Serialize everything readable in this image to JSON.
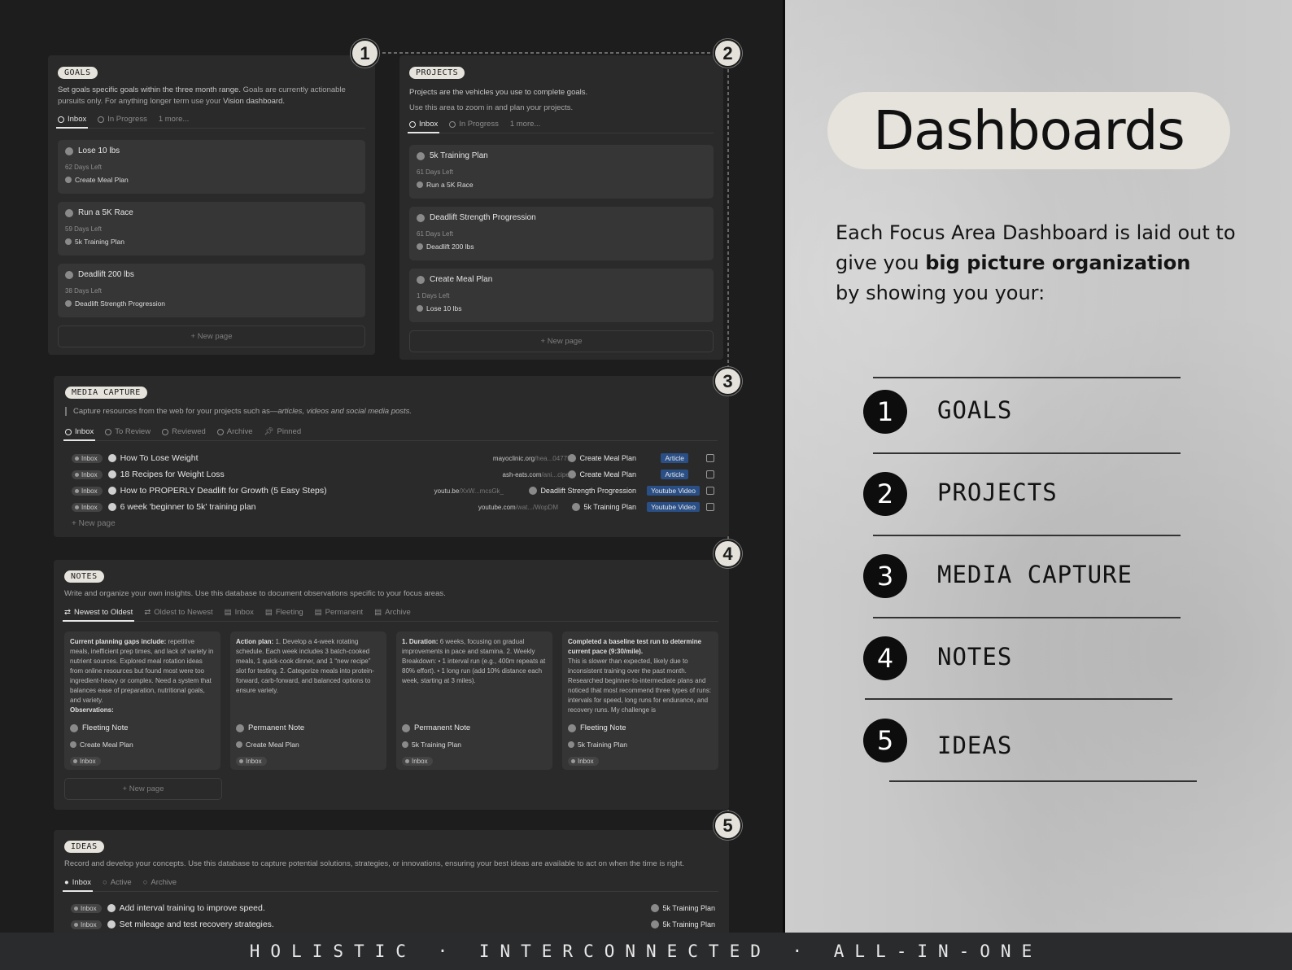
{
  "goals": {
    "pill": "GOALS",
    "desc_strong": "Set goals specific goals within the three month range.",
    "desc_rest": "Goals are currently actionable",
    "desc_line2": "pursuits only. For anything longer term use your",
    "desc_link": "Vision dashboard.",
    "tabs": [
      "Inbox",
      "In Progress",
      "1 more..."
    ],
    "cards": [
      {
        "title": "Lose 10 lbs",
        "sub": "62 Days Left",
        "link": "Create Meal Plan"
      },
      {
        "title": "Run a 5K Race",
        "sub": "59 Days Left",
        "link": "5k Training Plan"
      },
      {
        "title": "Deadlift 200 lbs",
        "sub": "38 Days Left",
        "link": "Deadlift Strength Progression"
      }
    ],
    "new_page": "+ New page"
  },
  "projects": {
    "pill": "PROJECTS",
    "desc_strong": "Projects are the vehicles you use to complete goals.",
    "desc_line2": "Use this area to zoom in and plan your projects.",
    "tabs": [
      "Inbox",
      "In Progress",
      "1 more..."
    ],
    "cards": [
      {
        "title": "5k Training Plan",
        "sub": "61 Days Left",
        "link": "Run a 5K Race"
      },
      {
        "title": "Deadlift Strength Progression",
        "sub": "61 Days Left",
        "link": "Deadlift 200 lbs"
      },
      {
        "title": "Create Meal Plan",
        "sub": "1 Days Left",
        "link": "Lose 10 lbs"
      }
    ],
    "new_page": "+ New page"
  },
  "media": {
    "pill": "MEDIA CAPTURE",
    "desc": "Capture resources from the web for your projects such as—",
    "desc_em": "articles, videos and social media posts.",
    "tabs": [
      "Inbox",
      "To Review",
      "Reviewed",
      "Archive",
      "Pinned"
    ],
    "rows": [
      {
        "status": "Inbox",
        "title": "How To Lose Weight",
        "url": "mayoclinic.org",
        "url_rest": "/hea...047752",
        "project": "Create Meal Plan",
        "tag": "Article"
      },
      {
        "status": "Inbox",
        "title": "18 Recipes for Weight Loss",
        "url": "ash-eats.com",
        "url_rest": "/ani...cipes/",
        "project": "Create Meal Plan",
        "tag": "Article"
      },
      {
        "status": "Inbox",
        "title": "How to PROPERLY Deadlift for Growth (5 Easy Steps)",
        "url": "youtu.be",
        "url_rest": "/XxW...mcsGk_",
        "project": "Deadlift Strength Progression",
        "tag": "Youtube Video"
      },
      {
        "status": "Inbox",
        "title": "6 week 'beginner to 5k' training plan",
        "url": "youtube.com",
        "url_rest": "/wat.../WopDM",
        "project": "5k Training Plan",
        "tag": "Youtube Video"
      }
    ],
    "new_page": "+ New page"
  },
  "notes": {
    "pill": "NOTES",
    "desc": "Write and organize your own insights. Use this database to document observations specific to your focus areas.",
    "tabs": [
      "Newest to Oldest",
      "Oldest to Newest",
      "Inbox",
      "Fleeting",
      "Permanent",
      "Archive"
    ],
    "cards": [
      {
        "lead": "Current planning gaps include:",
        "body": "repetitive meals, inefficient prep times, and lack of variety in nutrient sources. Explored meal rotation ideas from online resources but found most were too ingredient-heavy or complex. Need a system that balances ease of preparation, nutritional goals, and variety.",
        "tail": "Observations:",
        "type": "Fleeting Note",
        "rel": "Create Meal Plan",
        "status": "Inbox"
      },
      {
        "lead": "Action plan:",
        "body": "1. Develop a 4-week rotating schedule. Each week includes 3 batch-cooked meals, 1 quick-cook dinner, and 1 “new recipe” slot for testing. 2. Categorize meals into protein-forward, carb-forward, and balanced options to ensure variety.",
        "tail": "",
        "type": "Permanent Note",
        "rel": "Create Meal Plan",
        "status": "Inbox"
      },
      {
        "lead": "1. Duration:",
        "body": "6 weeks, focusing on gradual improvements in pace and stamina. 2. Weekly Breakdown: • 1 interval run (e.g., 400m repeats at 80% effort). • 1 long run (add 10% distance each week, starting at 3 miles).",
        "tail": "",
        "type": "Permanent Note",
        "rel": "5k Training Plan",
        "status": "Inbox"
      },
      {
        "lead": "Completed a baseline test run to determine current pace (9:30/mile).",
        "body": "This is slower than expected, likely due to inconsistent training over the past month. Researched beginner-to-intermediate plans and noticed that most recommend three types of runs: intervals for speed, long runs for endurance, and recovery runs. My challenge is",
        "tail": "",
        "type": "Fleeting Note",
        "rel": "5k Training Plan",
        "status": "Inbox"
      }
    ],
    "new_page": "+ New page"
  },
  "ideas": {
    "pill": "IDEAS",
    "desc": "Record and develop your concepts. Use this database to capture potential solutions, strategies, or innovations, ensuring your best ideas are available to act on when the time is right.",
    "tabs": [
      "Inbox",
      "Active",
      "Archive"
    ],
    "rows": [
      {
        "status": "Inbox",
        "title": "Add interval training to improve speed.",
        "project": "5k Training Plan"
      },
      {
        "status": "Inbox",
        "title": "Set mileage and test recovery strategies.",
        "project": "5k Training Plan"
      }
    ]
  },
  "markers": [
    "1",
    "2",
    "3",
    "4",
    "5"
  ],
  "right": {
    "title": "Dashboards",
    "intro_1": "Each Focus Area Dashboard is laid out to give you",
    "intro_bold": "big picture organization",
    "intro_2": "by showing you your:",
    "items": [
      {
        "num": "1",
        "label": "GOALS"
      },
      {
        "num": "2",
        "label": "PROJECTS"
      },
      {
        "num": "3",
        "label": "MEDIA CAPTURE"
      },
      {
        "num": "4",
        "label": "NOTES"
      },
      {
        "num": "5",
        "label": "IDEAS"
      }
    ]
  },
  "footer": "HOLISTIC · INTERCONNECTED · ALL-IN-ONE"
}
